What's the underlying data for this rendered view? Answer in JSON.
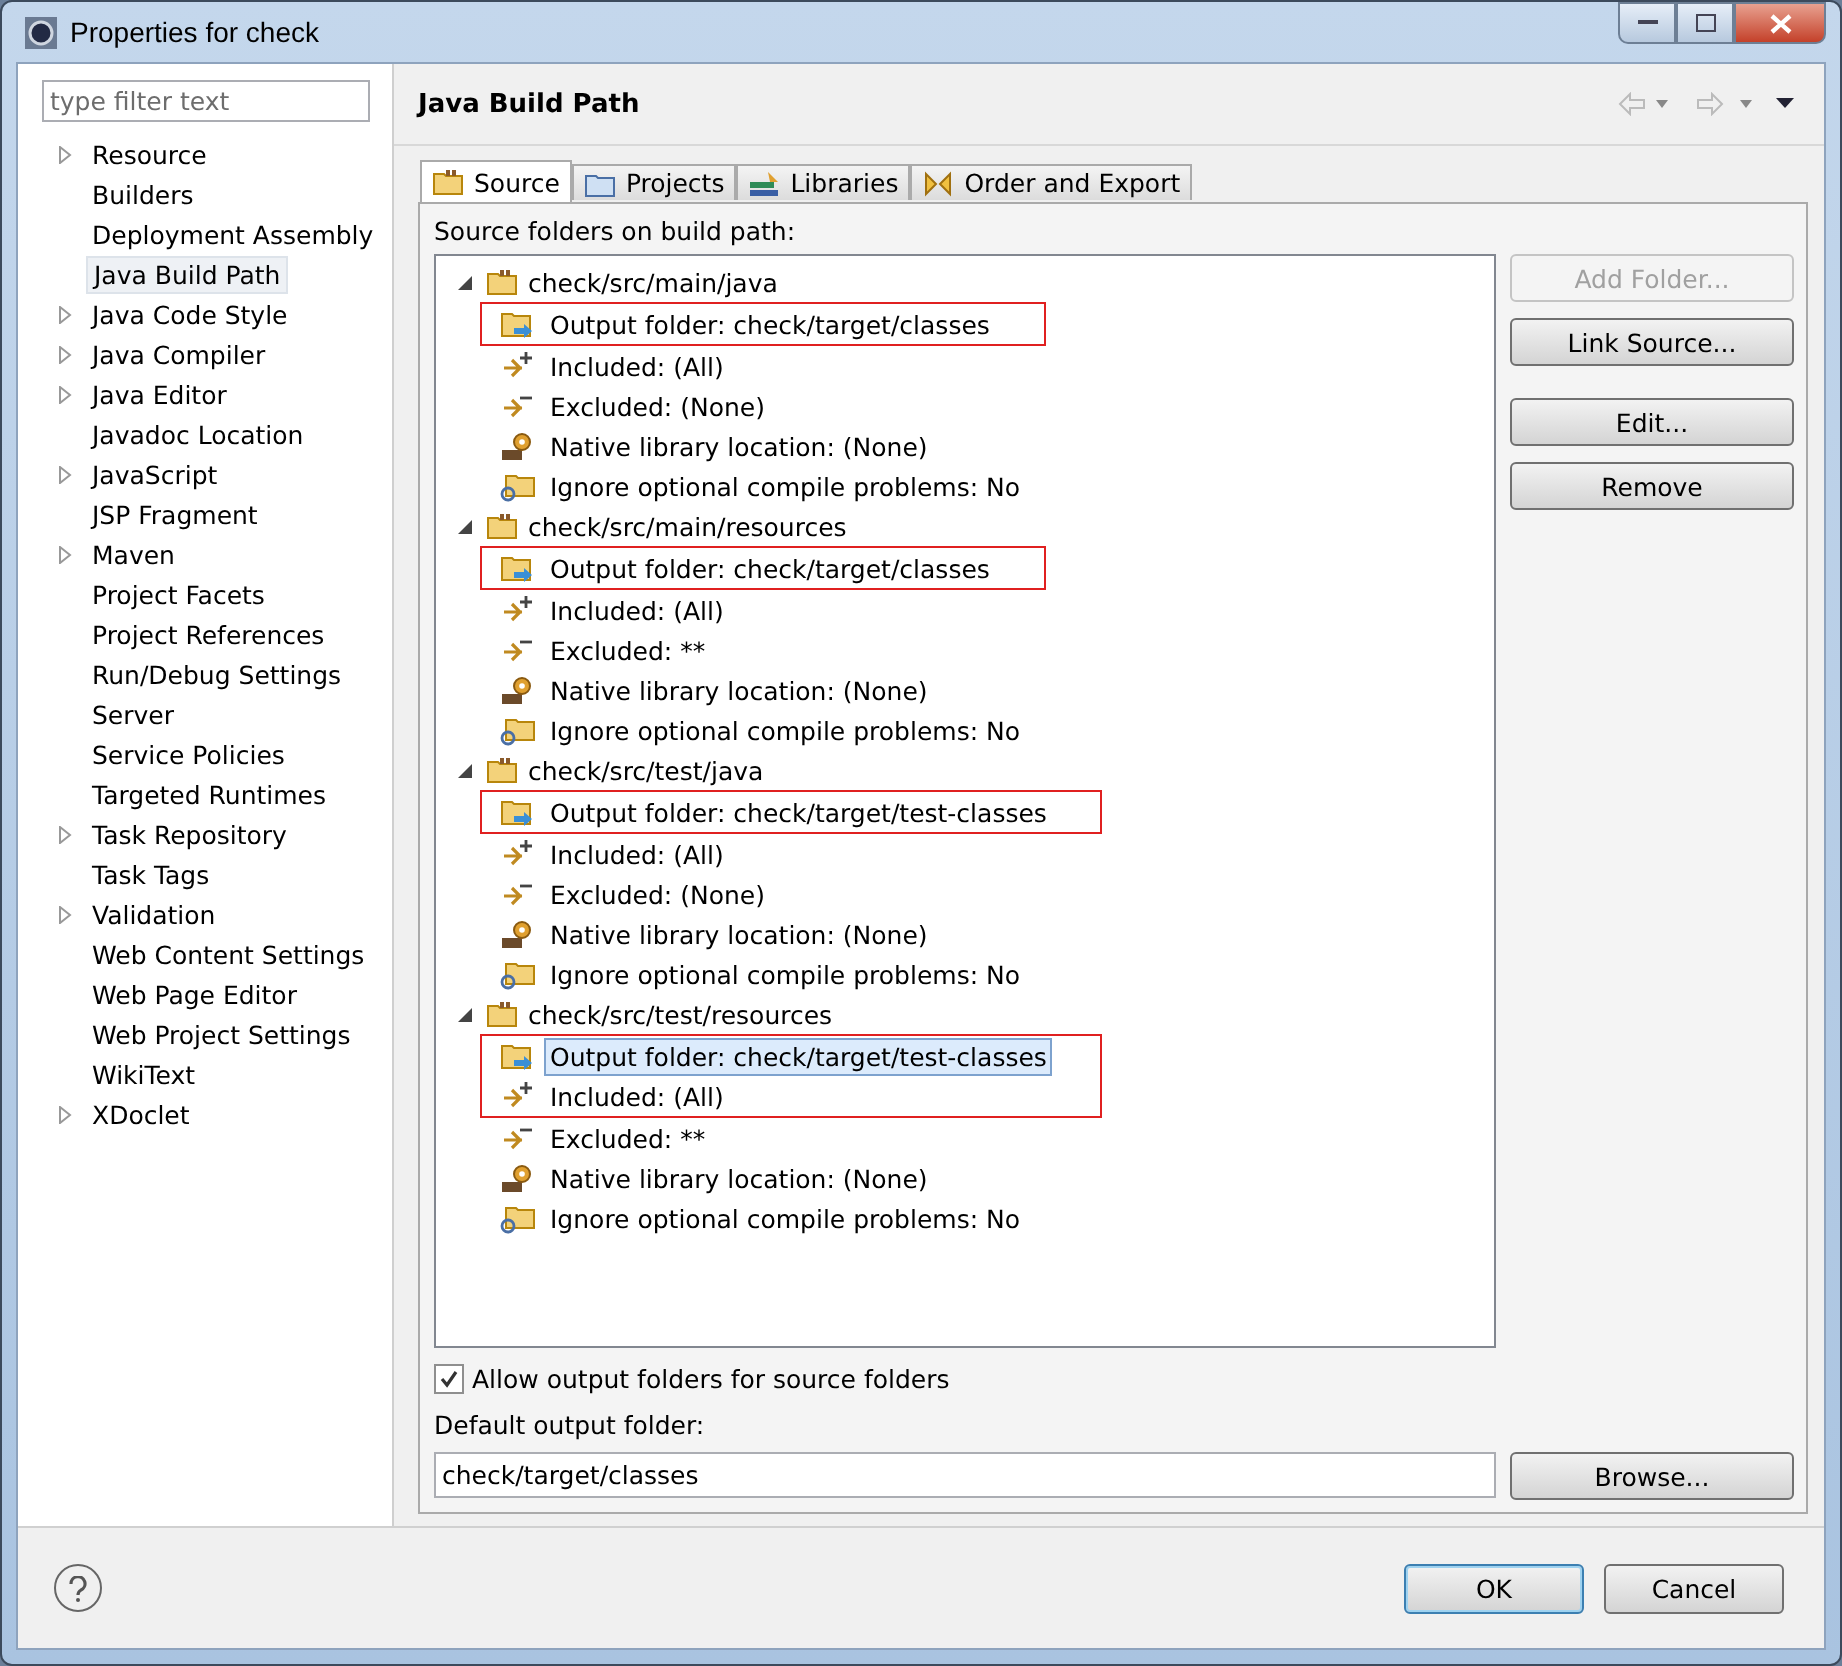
{
  "window": {
    "title": "Properties for check"
  },
  "sidebar": {
    "filter_placeholder": "type filter text",
    "items": [
      {
        "label": "Resource",
        "expandable": true,
        "selected": false
      },
      {
        "label": "Builders",
        "expandable": false,
        "selected": false
      },
      {
        "label": "Deployment Assembly",
        "expandable": false,
        "selected": false
      },
      {
        "label": "Java Build Path",
        "expandable": false,
        "selected": true
      },
      {
        "label": "Java Code Style",
        "expandable": true,
        "selected": false
      },
      {
        "label": "Java Compiler",
        "expandable": true,
        "selected": false
      },
      {
        "label": "Java Editor",
        "expandable": true,
        "selected": false
      },
      {
        "label": "Javadoc Location",
        "expandable": false,
        "selected": false
      },
      {
        "label": "JavaScript",
        "expandable": true,
        "selected": false
      },
      {
        "label": "JSP Fragment",
        "expandable": false,
        "selected": false
      },
      {
        "label": "Maven",
        "expandable": true,
        "selected": false
      },
      {
        "label": "Project Facets",
        "expandable": false,
        "selected": false
      },
      {
        "label": "Project References",
        "expandable": false,
        "selected": false
      },
      {
        "label": "Run/Debug Settings",
        "expandable": false,
        "selected": false
      },
      {
        "label": "Server",
        "expandable": false,
        "selected": false
      },
      {
        "label": "Service Policies",
        "expandable": false,
        "selected": false
      },
      {
        "label": "Targeted Runtimes",
        "expandable": false,
        "selected": false
      },
      {
        "label": "Task Repository",
        "expandable": true,
        "selected": false
      },
      {
        "label": "Task Tags",
        "expandable": false,
        "selected": false
      },
      {
        "label": "Validation",
        "expandable": true,
        "selected": false
      },
      {
        "label": "Web Content Settings",
        "expandable": false,
        "selected": false
      },
      {
        "label": "Web Page Editor",
        "expandable": false,
        "selected": false
      },
      {
        "label": "Web Project Settings",
        "expandable": false,
        "selected": false
      },
      {
        "label": "WikiText",
        "expandable": false,
        "selected": false
      },
      {
        "label": "XDoclet",
        "expandable": true,
        "selected": false
      }
    ]
  },
  "page": {
    "title": "Java Build Path",
    "tabs": [
      {
        "label": "Source",
        "kind": "source",
        "selected": true
      },
      {
        "label": "Projects",
        "kind": "projects",
        "selected": false
      },
      {
        "label": "Libraries",
        "kind": "libraries",
        "selected": false
      },
      {
        "label": "Order and Export",
        "kind": "order",
        "selected": false
      }
    ],
    "tree_label": "Source folders on build path:",
    "tree": [
      {
        "label": "check/src/main/java",
        "expanded": true,
        "children": [
          {
            "label": "Output folder: check/target/classes",
            "kind": "output",
            "selected": false,
            "marked": true
          },
          {
            "label": "Included: (All)",
            "kind": "included",
            "selected": false,
            "marked": false
          },
          {
            "label": "Excluded: (None)",
            "kind": "excluded",
            "selected": false,
            "marked": false
          },
          {
            "label": "Native library location: (None)",
            "kind": "native",
            "selected": false,
            "marked": false
          },
          {
            "label": "Ignore optional compile problems: No",
            "kind": "ignore",
            "selected": false,
            "marked": false
          }
        ]
      },
      {
        "label": "check/src/main/resources",
        "expanded": true,
        "children": [
          {
            "label": "Output folder: check/target/classes",
            "kind": "output",
            "selected": false,
            "marked": true
          },
          {
            "label": "Included: (All)",
            "kind": "included",
            "selected": false,
            "marked": false
          },
          {
            "label": "Excluded: **",
            "kind": "excluded",
            "selected": false,
            "marked": false
          },
          {
            "label": "Native library location: (None)",
            "kind": "native",
            "selected": false,
            "marked": false
          },
          {
            "label": "Ignore optional compile problems: No",
            "kind": "ignore",
            "selected": false,
            "marked": false
          }
        ]
      },
      {
        "label": "check/src/test/java",
        "expanded": true,
        "children": [
          {
            "label": "Output folder: check/target/test-classes",
            "kind": "output",
            "selected": false,
            "marked": true
          },
          {
            "label": "Included: (All)",
            "kind": "included",
            "selected": false,
            "marked": false
          },
          {
            "label": "Excluded: (None)",
            "kind": "excluded",
            "selected": false,
            "marked": false
          },
          {
            "label": "Native library location: (None)",
            "kind": "native",
            "selected": false,
            "marked": false
          },
          {
            "label": "Ignore optional compile problems: No",
            "kind": "ignore",
            "selected": false,
            "marked": false
          }
        ]
      },
      {
        "label": "check/src/test/resources",
        "expanded": true,
        "children": [
          {
            "label": "Output folder: check/target/test-classes",
            "kind": "output",
            "selected": true,
            "marked": true
          },
          {
            "label": "Included: (All)",
            "kind": "included",
            "selected": false,
            "marked": true
          },
          {
            "label": "Excluded: **",
            "kind": "excluded",
            "selected": false,
            "marked": false
          },
          {
            "label": "Native library location: (None)",
            "kind": "native",
            "selected": false,
            "marked": false
          },
          {
            "label": "Ignore optional compile problems: No",
            "kind": "ignore",
            "selected": false,
            "marked": false
          }
        ]
      }
    ],
    "side_buttons": [
      {
        "label": "Add Folder...",
        "disabled": true
      },
      {
        "label": "Link Source...",
        "disabled": false
      },
      {
        "label": "Edit...",
        "disabled": false
      },
      {
        "label": "Remove",
        "disabled": false
      }
    ],
    "allow_output": {
      "label": "Allow output folders for source folders",
      "checked": true
    },
    "default_output": {
      "label": "Default output folder:",
      "value": "check/target/classes",
      "button": "Browse..."
    }
  },
  "buttons": [
    {
      "label": "OK",
      "default": true
    },
    {
      "label": "Cancel",
      "default": false
    }
  ]
}
